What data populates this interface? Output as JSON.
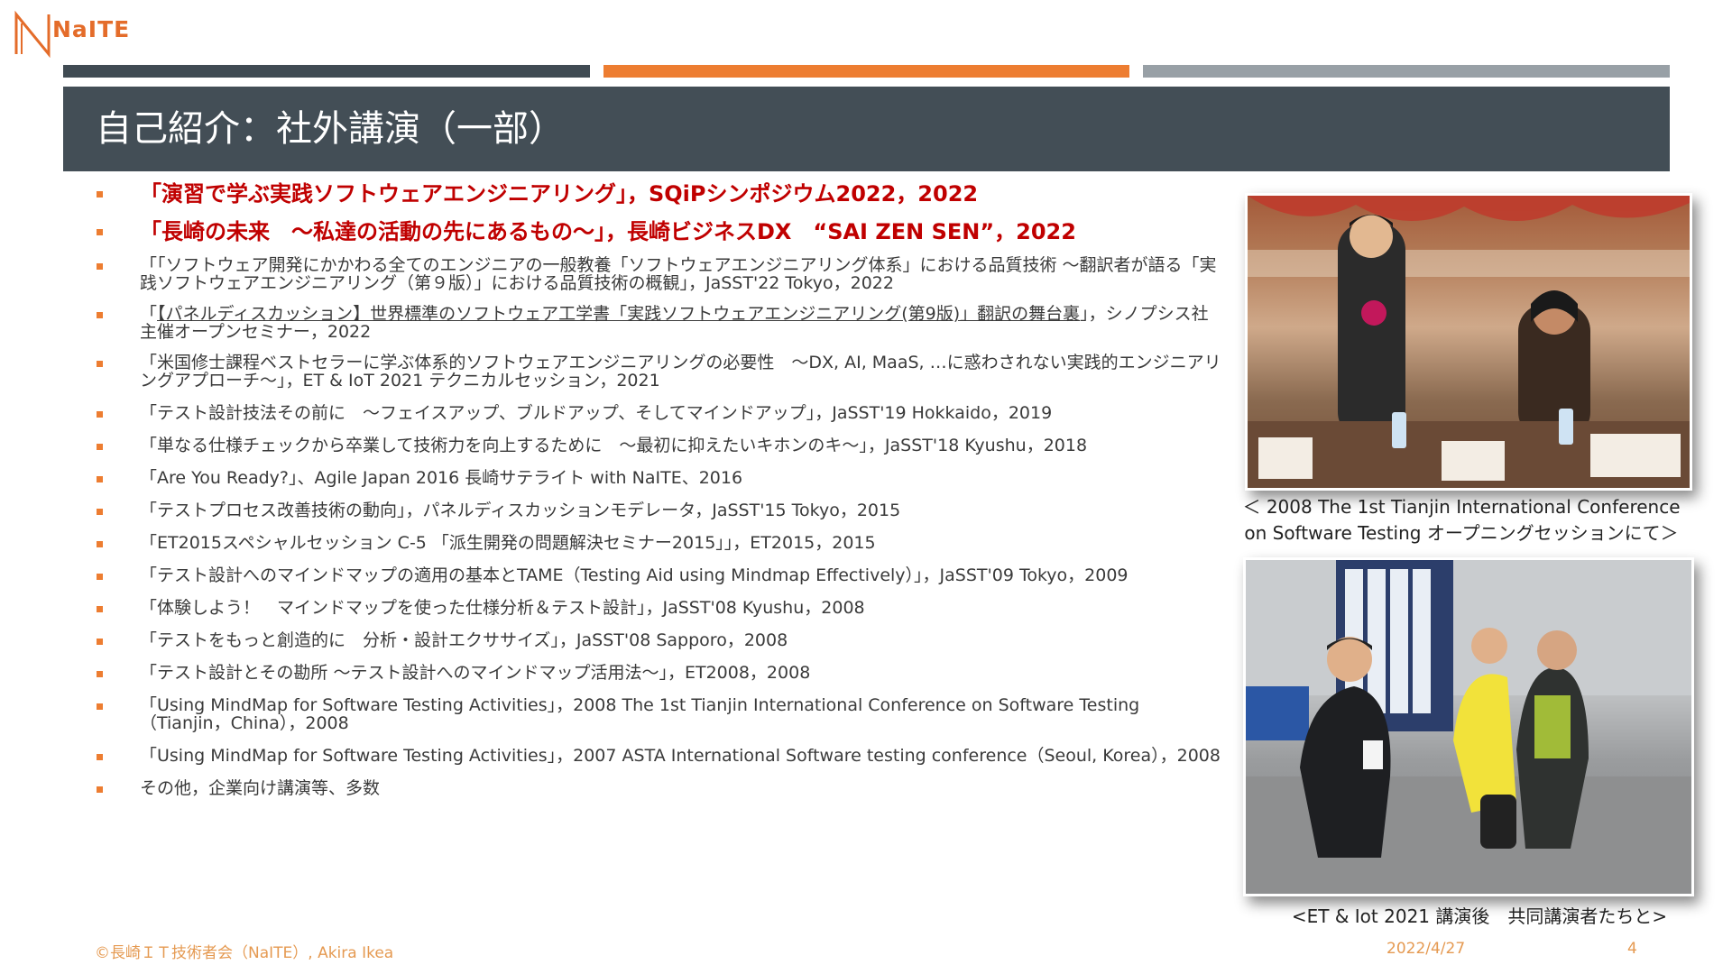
{
  "logo": {
    "text": "NaITE"
  },
  "title": "自己紹介：社外講演（一部）",
  "talks": [
    {
      "text": "「演習で学ぶ実践ソフトウェアエンジニアリング」，SQiPシンポジウム2022，2022"
    },
    {
      "text": "「長崎の未来　～私達の活動の先にあるもの～」，長崎ビジネスDX　“SAI ZEN SEN”，2022"
    },
    {
      "text": "「「ソフトウェア開発にかかわる全てのエンジニアの一般教養「ソフトウェアエンジニアリング体系」における品質技術 ～翻訳者が語る「実践ソフトウェアエンジニアリング（第９版）」における品質技術の概観」，JaSST'22 Tokyo，2022"
    },
    {
      "underlined": "【パネルディスカッション】世界標準のソフトウェア工学書「実践ソフトウェアエンジニアリング(第9版)」翻訳の舞台裏",
      "prefix": "「",
      "suffix": "」，シノプシス社主催オープンセミナー，2022"
    },
    {
      "text": "「米国修士課程ベストセラーに学ぶ体系的ソフトウェアエンジニアリングの必要性　～DX, AI, MaaS, …に惑わされない実践的エンジニアリングアプローチ～」，ET & IoT 2021 テクニカルセッション，2021"
    },
    {
      "text": "「テスト設計技法その前に　～フェイスアップ、ブルドアップ、そしてマインドアップ」，JaSST'19 Hokkaido，2019"
    },
    {
      "text": "「単なる仕様チェックから卒業して技術力を向上するために　～最初に抑えたいキホンのキ～」，JaSST'18 Kyushu，2018"
    },
    {
      "text": "「Are You Ready?」、Agile Japan 2016 長崎サテライト with NaITE、2016"
    },
    {
      "text": "「テストプロセス改善技術の動向」，パネルディスカッションモデレータ，JaSST'15 Tokyo，2015"
    },
    {
      "text": "「ET2015スペシャルセッション C-5 「派生開発の問題解決セミナー2015」」，ET2015，2015"
    },
    {
      "text": "「テスト設計へのマインドマップの適用の基本とTAME（Testing Aid using Mindmap Effectively）」，JaSST'09 Tokyo，2009"
    },
    {
      "text": "「体験しよう！　マインドマップを使った仕様分析＆テスト設計」，JaSST'08 Kyushu，2008"
    },
    {
      "text": "「テストをもっと創造的に　分析・設計エクササイズ」，JaSST'08 Sapporo，2008"
    },
    {
      "text": "「テスト設計とその勘所 ～テスト設計へのマインドマップ活用法～」，ET2008，2008"
    },
    {
      "text": "「Using MindMap for Software Testing Activities」，2008 The 1st Tianjin International Conference on Software Testing（Tianjin，China），2008"
    },
    {
      "text": "「Using MindMap for Software Testing Activities」，2007 ASTA International Software testing conference（Seoul, Korea），2008"
    },
    {
      "text": "その他，企業向け講演等、多数"
    }
  ],
  "photos": {
    "top": {
      "caption_line1": "＜ 2008 The 1st Tianjin International Conference",
      "caption_line2": "on Software Testing オープニングセッションにて＞"
    },
    "bottom": {
      "caption": "<ET & Iot 2021 講演後　共同講演者たちと>"
    }
  },
  "footer": {
    "copyright": "©長崎ＩＴ技術者会（NaITE）, Akira Ikea",
    "date": "2022/4/27",
    "page": "4"
  },
  "colors": {
    "accent": "#ed7d31",
    "title_band": "#434e56",
    "highlight": "#c00000",
    "bar_dark": "#404b53",
    "bar_gray": "#98a0a6",
    "footer": "#e59a52"
  }
}
